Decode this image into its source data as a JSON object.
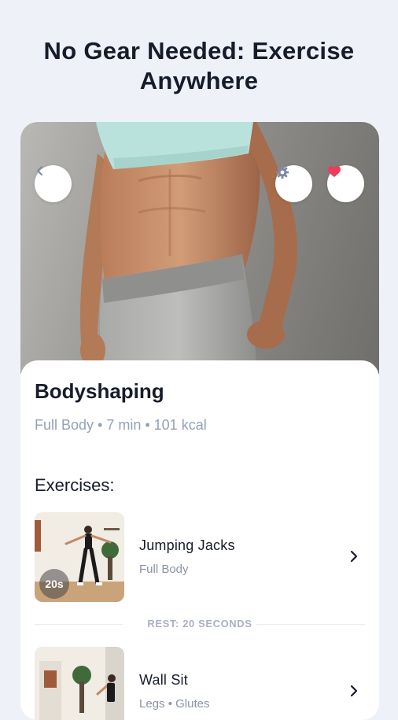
{
  "headline": {
    "line1": "No Gear Needed: Exercise",
    "line2": "Anywhere"
  },
  "hero": {
    "back_icon": "chevron-left-icon",
    "settings_icon": "gear-icon",
    "favorite_icon": "heart-icon",
    "favorite_color": "#ef3b5b"
  },
  "workout": {
    "title": "Bodyshaping",
    "meta": "Full Body • 7 min • 101 kcal"
  },
  "exercises_section": {
    "title": "Exercises:",
    "items": [
      {
        "name": "Jumping Jacks",
        "subtitle": "Full Body",
        "duration": "20s"
      },
      {
        "name": "Wall Sit",
        "subtitle": "Legs • Glutes",
        "duration": ""
      }
    ],
    "rest_label": "REST: 20 SECONDS"
  },
  "colors": {
    "background": "#eef2f8",
    "title_text": "#161c2a",
    "muted_text": "#94a0b8",
    "rest_text": "#a8b1c3"
  }
}
